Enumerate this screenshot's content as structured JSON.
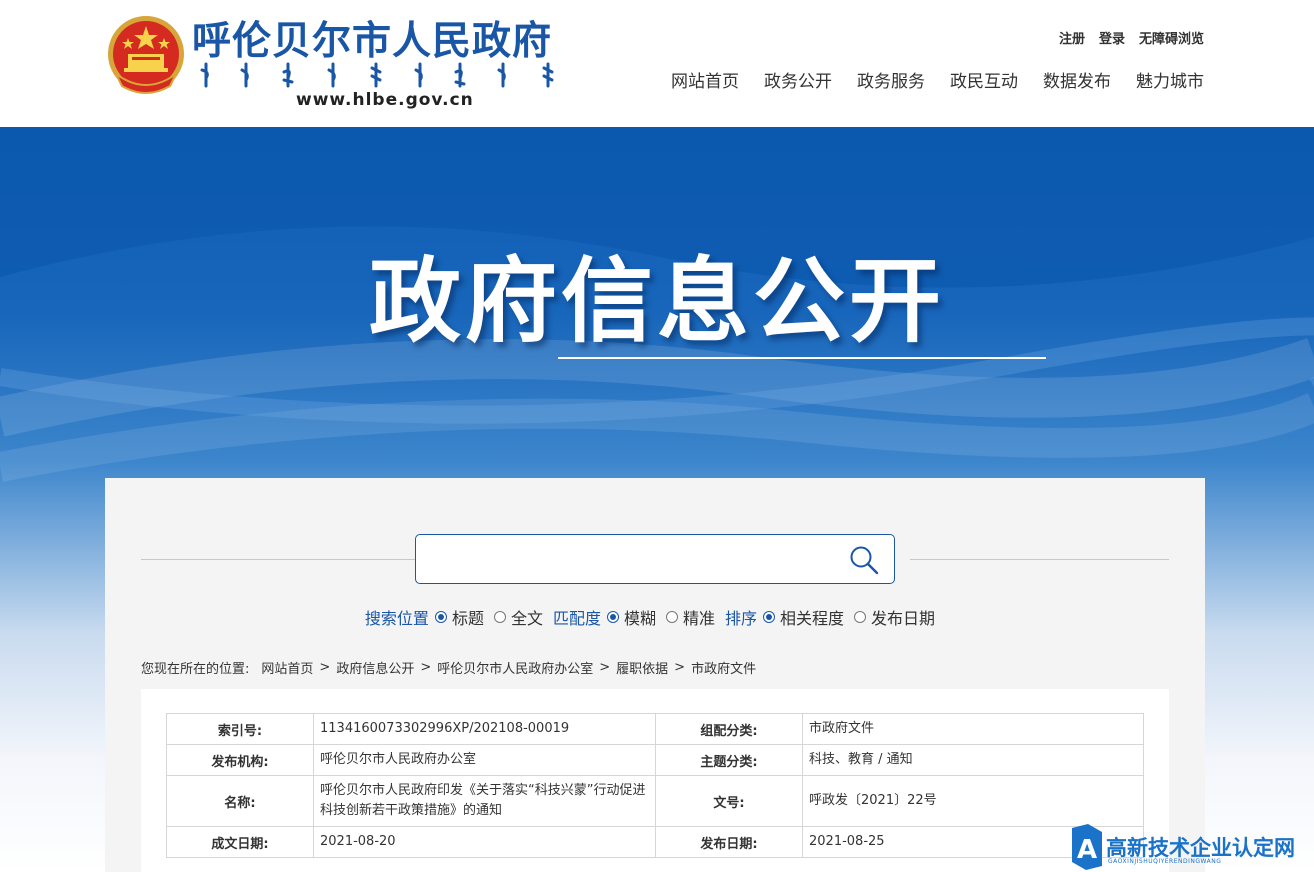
{
  "header": {
    "site_title": "呼伦贝尔市人民政府",
    "site_url": "www.hlbe.gov.cn",
    "top_links": [
      "注册",
      "登录",
      "无障碍浏览"
    ],
    "nav": [
      "网站首页",
      "政务公开",
      "政务服务",
      "政民互动",
      "数据发布",
      "魅力城市"
    ]
  },
  "banner": {
    "title": "政府信息公开"
  },
  "search": {
    "value": "",
    "placeholder": "",
    "position_label": "搜索位置",
    "position_options": [
      {
        "label": "标题",
        "selected": true
      },
      {
        "label": "全文",
        "selected": false
      }
    ],
    "match_label": "匹配度",
    "match_options": [
      {
        "label": "模糊",
        "selected": true
      },
      {
        "label": "精准",
        "selected": false
      }
    ],
    "sort_label": "排序",
    "sort_options": [
      {
        "label": "相关程度",
        "selected": true
      },
      {
        "label": "发布日期",
        "selected": false
      }
    ]
  },
  "breadcrumb": {
    "prefix": "您现在所在的位置:",
    "items": [
      "网站首页",
      "政府信息公开",
      "呼伦贝尔市人民政府办公室",
      "履职依据",
      "市政府文件"
    ],
    "separator": ">"
  },
  "info_table": {
    "rows": [
      {
        "k1": "索引号:",
        "v1": "1134160073302996XP/202108-00019",
        "k2": "组配分类:",
        "v2": "市政府文件"
      },
      {
        "k1": "发布机构:",
        "v1": "呼伦贝尔市人民政府办公室",
        "k2": "主题分类:",
        "v2": "科技、教育 / 通知"
      },
      {
        "k1": "名称:",
        "v1": "呼伦贝尔市人民政府印发《关于落实“科技兴蒙”行动促进科技创新若干政策措施》的通知",
        "k2": "文号:",
        "v2": "呼政发〔2021〕22号"
      },
      {
        "k1": "成文日期:",
        "v1": "2021-08-20",
        "k2": "发布日期:",
        "v2": "2021-08-25"
      }
    ]
  },
  "watermark": {
    "text": "高新技术企业认定网",
    "sub": "GAOXINJISHUQIYERENDINGWANG"
  },
  "colors": {
    "brand_blue": "#1a56a6",
    "banner_blue": "#0e5db3"
  }
}
